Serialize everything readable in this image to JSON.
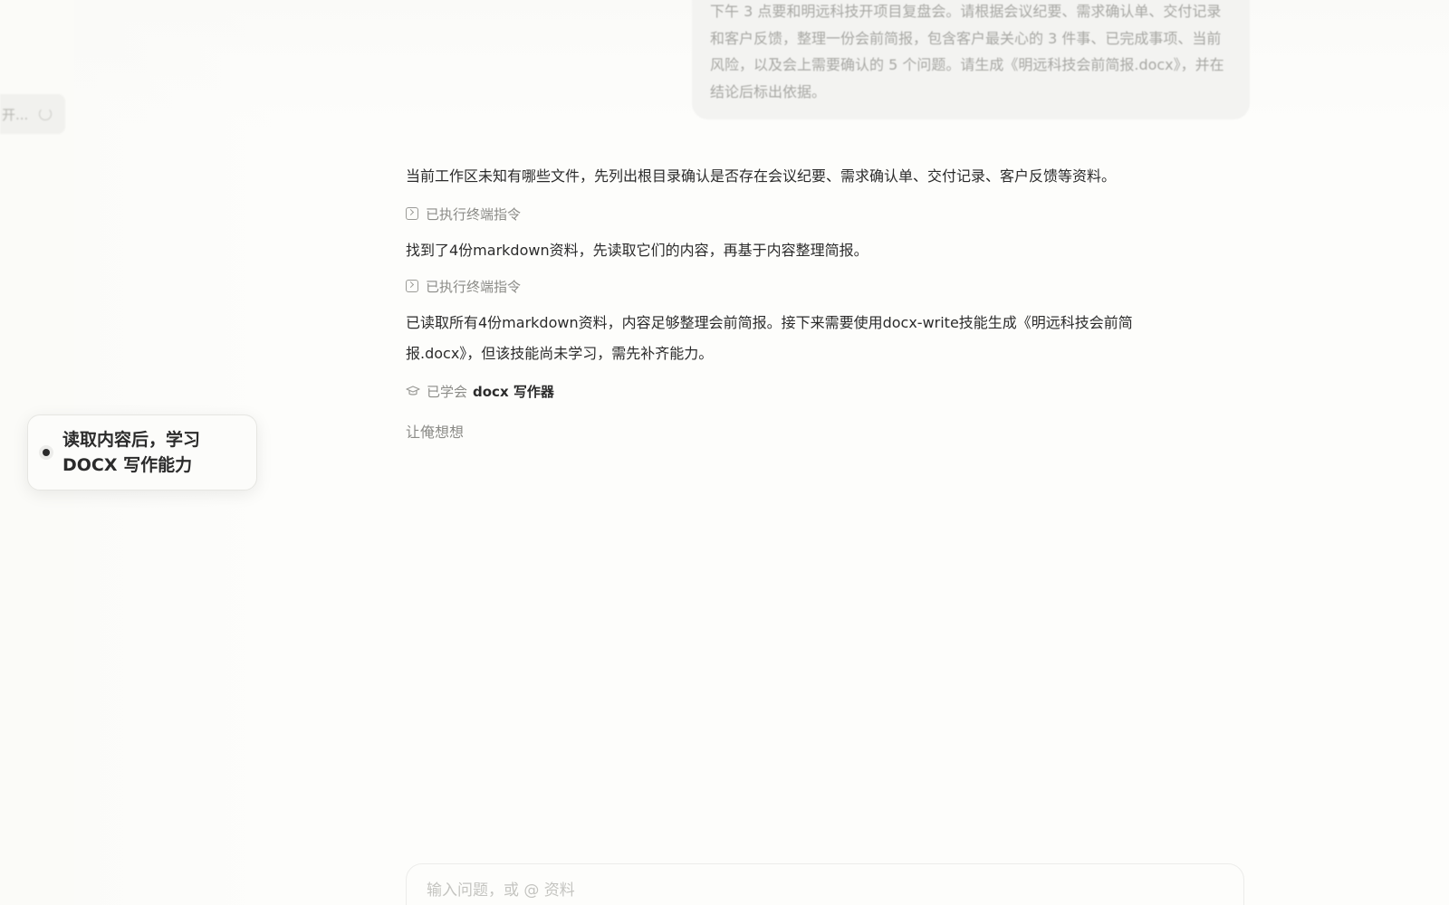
{
  "sidebar": {
    "active_item_label": "开..."
  },
  "user_message": {
    "text": "下午 3 点要和明远科技开项目复盘会。请根据会议纪要、需求确认单、交付记录和客户反馈，整理一份会前简报，包含客户最关心的 3 件事、已完成事项、当前风险，以及会上需要确认的 5 个问题。请生成《明远科技会前简报.docx》，并在结论后标出依据。"
  },
  "messages": {
    "msg1": "当前工作区未知有哪些文件，先列出根目录确认是否存在会议纪要、需求确认单、交付记录、客户反馈等资料。",
    "tool1": "已执行终端指令",
    "msg2": "找到了4份markdown资料，先读取它们的内容，再基于内容整理简报。",
    "tool2": "已执行终端指令",
    "msg3": "已读取所有4份markdown资料，内容足够整理会前简报。接下来需要使用docx-write技能生成《明远科技会前简报.docx》，但该技能尚未学习，需先补齐能力。",
    "skill_prefix": "已学会",
    "skill_name": "docx 写作器",
    "thinking": "让俺想想"
  },
  "tooltip": {
    "text": "读取内容后，学习\nDOCX 写作能力"
  },
  "input": {
    "placeholder": "输入问题，或 @ 资料"
  }
}
